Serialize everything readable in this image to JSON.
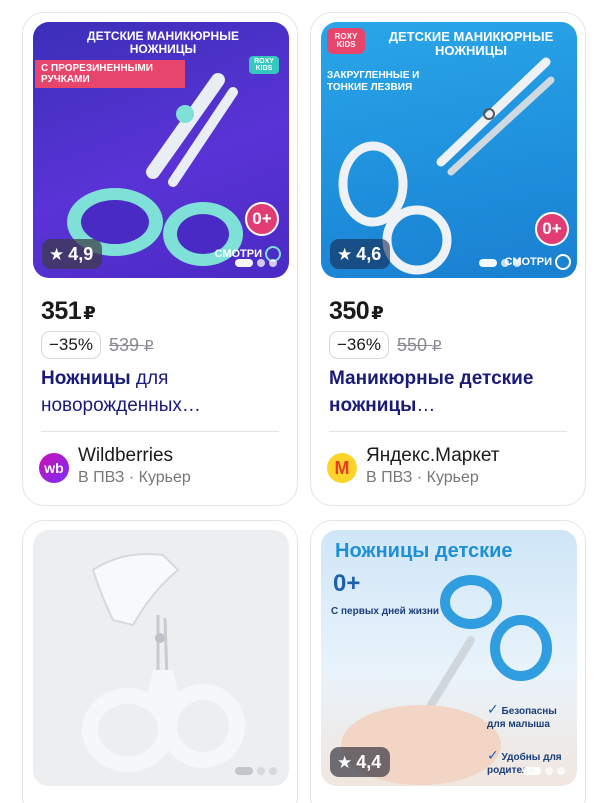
{
  "products": [
    {
      "image": {
        "header": "ДЕТСКИЕ МАНИКЮРНЫЕ НОЖНИЦЫ",
        "tag": "С ПРОРЕЗИНЕННЫМИ РУЧКАМИ",
        "brand": "ROXY KIDS",
        "age_badge": "0+",
        "cta": "СМОТРИ"
      },
      "rating": "4,9",
      "price": "351",
      "currency": "₽",
      "discount": "−35%",
      "old_price": "539",
      "title_bold": "Ножницы",
      "title_rest": " для новорожденных…",
      "seller": {
        "logo": "wb",
        "name": "Wildberries",
        "delivery": "В ПВЗ · Курьер"
      }
    },
    {
      "image": {
        "header": "ДЕТСКИЕ МАНИКЮРНЫЕ НОЖНИЦЫ",
        "tag": "ЗАКРУГЛЕННЫЕ И ТОНКИЕ ЛЕЗВИЯ",
        "brand": "ROXY KIDS",
        "age_badge": "0+",
        "cta": "СМОТРИ"
      },
      "rating": "4,6",
      "price": "350",
      "currency": "₽",
      "discount": "−36%",
      "old_price": "550",
      "title_bold": "Маникюрные детские ножницы",
      "title_rest": "…",
      "seller": {
        "logo": "M",
        "name": "Яндекс.Маркет",
        "delivery": "В ПВЗ · Курьер"
      }
    },
    {
      "image": {},
      "rating": "",
      "price": "",
      "currency": "",
      "discount": "",
      "old_price": "",
      "title_bold": "",
      "title_rest": "",
      "seller": {
        "logo": "",
        "name": "",
        "delivery": ""
      }
    },
    {
      "image": {
        "header": "Ножницы детские",
        "age_badge": "0+",
        "tag": "С первых дней жизни",
        "feature1": "Безопасны для малыша",
        "feature2": "Удобны для родителя"
      },
      "rating": "4,4",
      "price": "",
      "currency": "",
      "discount": "",
      "old_price": "",
      "title_bold": "",
      "title_rest": "",
      "seller": {
        "logo": "",
        "name": "",
        "delivery": ""
      }
    }
  ],
  "colors": {
    "title": "#1a1a7a",
    "wildberries": "#a73afd",
    "yandex_market": "#fed42b",
    "rating_bg": "#3c3c46"
  }
}
